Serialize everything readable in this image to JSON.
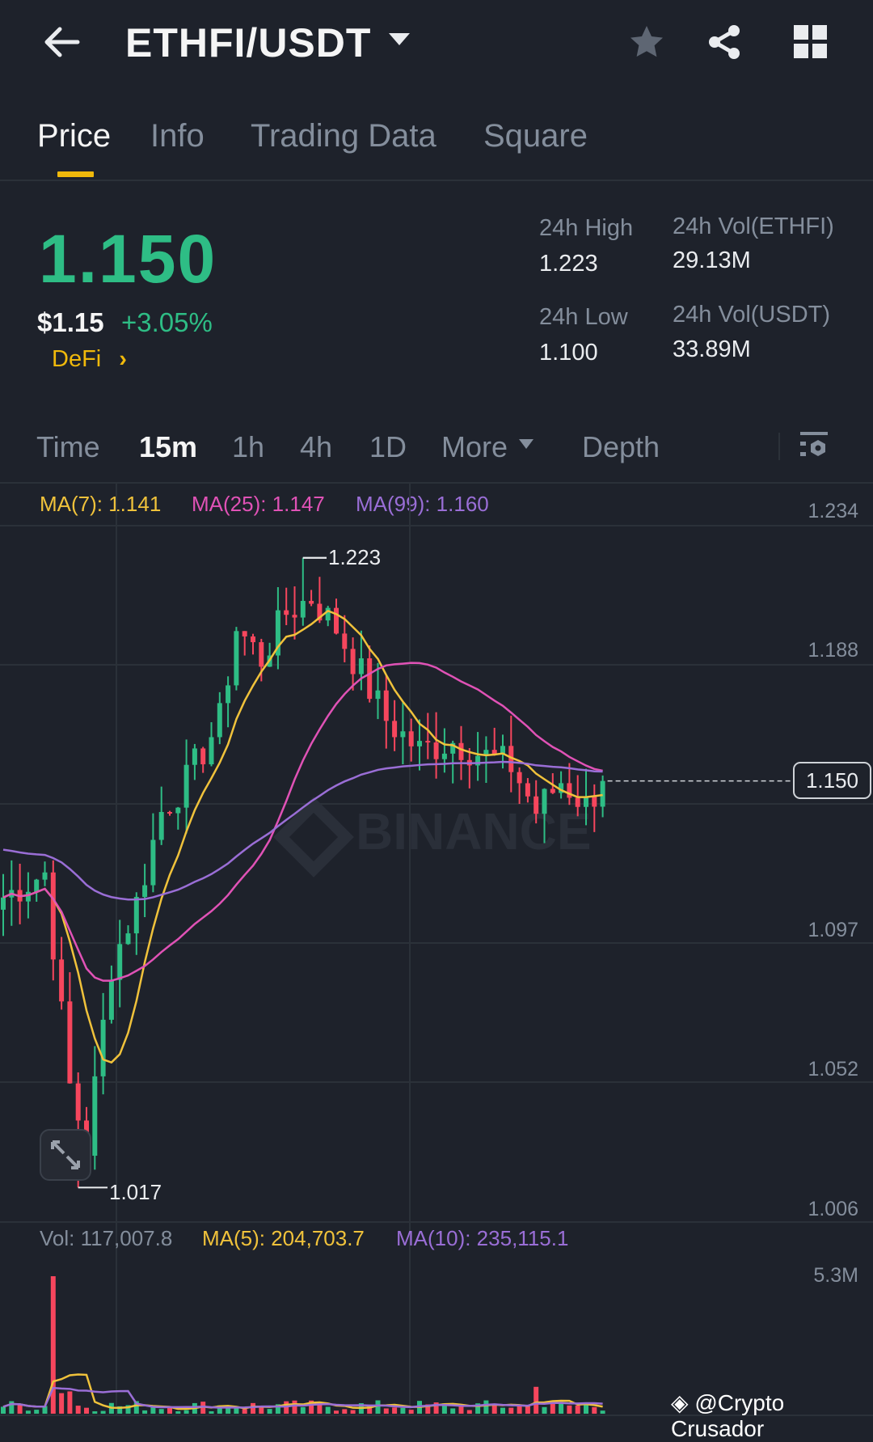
{
  "header": {
    "title": "ETHFI/USDT",
    "back_icon": "arrow-left-icon",
    "actions": [
      "star-icon",
      "share-icon",
      "grid-icon"
    ]
  },
  "tabs": [
    {
      "label": "Price",
      "active": true
    },
    {
      "label": "Info"
    },
    {
      "label": "Trading Data"
    },
    {
      "label": "Square"
    }
  ],
  "ticker": {
    "last_price": "1.150",
    "usd_price": "$1.15",
    "change": "+3.05%",
    "category": "DeFi",
    "high_label": "24h High",
    "high": "1.223",
    "low_label": "24h Low",
    "low": "1.100",
    "vol_base_label": "24h Vol(ETHFI)",
    "vol_base": "29.13M",
    "vol_quote_label": "24h Vol(USDT)",
    "vol_quote": "33.89M"
  },
  "intervals": {
    "time": "Time",
    "items": [
      "15m",
      "1h",
      "4h",
      "1D"
    ],
    "active": "15m",
    "more": "More",
    "depth": "Depth"
  },
  "ma": {
    "ma7": "MA(7): 1.141",
    "ma25": "MA(25): 1.147",
    "ma99": "MA(99): 1.160"
  },
  "colors": {
    "up": "#2ebd85",
    "down": "#f6465d",
    "ma7": "#f0c23b",
    "ma25": "#e052b6",
    "ma99": "#9a6ed6",
    "accent": "#f0b90b"
  },
  "chart_data": {
    "type": "candlestick",
    "y_ticks": [
      "1.234",
      "1.188",
      "1.097",
      "1.052",
      "1.006"
    ],
    "current_price_label": "1.150",
    "high_marker": "1.223",
    "low_marker": "1.017",
    "watermark": "BINANCE",
    "close_keypoints": [
      [
        0,
        1.112
      ],
      [
        5,
        1.12
      ],
      [
        8,
        1.05
      ],
      [
        10,
        1.03
      ],
      [
        13,
        1.09
      ],
      [
        16,
        1.11
      ],
      [
        19,
        1.14
      ],
      [
        22,
        1.15
      ],
      [
        26,
        1.17
      ],
      [
        28,
        1.2
      ],
      [
        31,
        1.19
      ],
      [
        34,
        1.205
      ],
      [
        37,
        1.21
      ],
      [
        40,
        1.2
      ],
      [
        43,
        1.185
      ],
      [
        46,
        1.17
      ],
      [
        50,
        1.16
      ],
      [
        54,
        1.163
      ],
      [
        58,
        1.158
      ],
      [
        61,
        1.155
      ],
      [
        64,
        1.14
      ],
      [
        67,
        1.15
      ],
      [
        70,
        1.142
      ],
      [
        72,
        1.15
      ]
    ],
    "volume": {
      "label": "Vol: 117,007.8",
      "ma5": "MA(5): 204,703.7",
      "ma10": "MA(10): 235,115.1",
      "y_tick": "5.3M",
      "spike_value_m": 5.3
    }
  },
  "watermark_text": "@Crypto Crusador"
}
